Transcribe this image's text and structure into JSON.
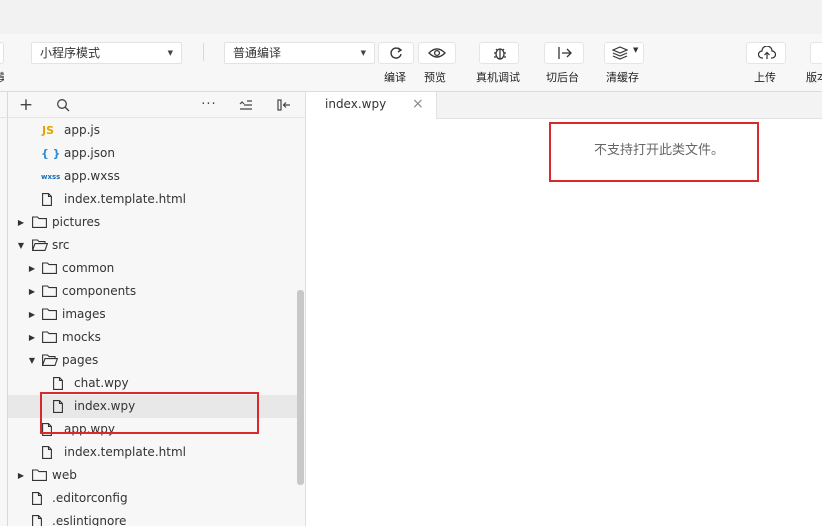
{
  "toolbar": {
    "mode_select": "小程序模式",
    "compile_select": "普通编译",
    "buttons": {
      "compile": "编译",
      "preview": "预览",
      "remote_debug": "真机调试",
      "switch_background": "切后台",
      "clear_cache": "清缓存",
      "upload": "上传",
      "version": "版本"
    },
    "left_edge_label": "模"
  },
  "sidebar": {
    "tree": [
      {
        "label": "app.js",
        "type": "js"
      },
      {
        "label": "app.json",
        "type": "json"
      },
      {
        "label": "app.wxss",
        "type": "wxss"
      },
      {
        "label": "index.template.html",
        "type": "file"
      },
      {
        "label": "pictures",
        "type": "folder"
      },
      {
        "label": "src",
        "type": "folder-open"
      },
      {
        "label": "common",
        "type": "folder"
      },
      {
        "label": "components",
        "type": "folder"
      },
      {
        "label": "images",
        "type": "folder"
      },
      {
        "label": "mocks",
        "type": "folder"
      },
      {
        "label": "pages",
        "type": "folder-open"
      },
      {
        "label": "chat.wpy",
        "type": "file"
      },
      {
        "label": "index.wpy",
        "type": "file"
      },
      {
        "label": "app.wpy",
        "type": "file"
      },
      {
        "label": "index.template.html",
        "type": "file"
      },
      {
        "label": "web",
        "type": "folder"
      },
      {
        "label": ".editorconfig",
        "type": "file"
      },
      {
        "label": ".eslintignore",
        "type": "file"
      }
    ],
    "wxss_icon_text": "wxss",
    "js_icon_text": "JS",
    "json_icon_text": "{ }"
  },
  "editor": {
    "tab_title": "index.wpy",
    "message": "不支持打开此类文件。"
  },
  "colors": {
    "highlight_red": "#d9292b",
    "sidebar_bg": "#f7f7f7",
    "selected_row": "#e8e8e8"
  }
}
